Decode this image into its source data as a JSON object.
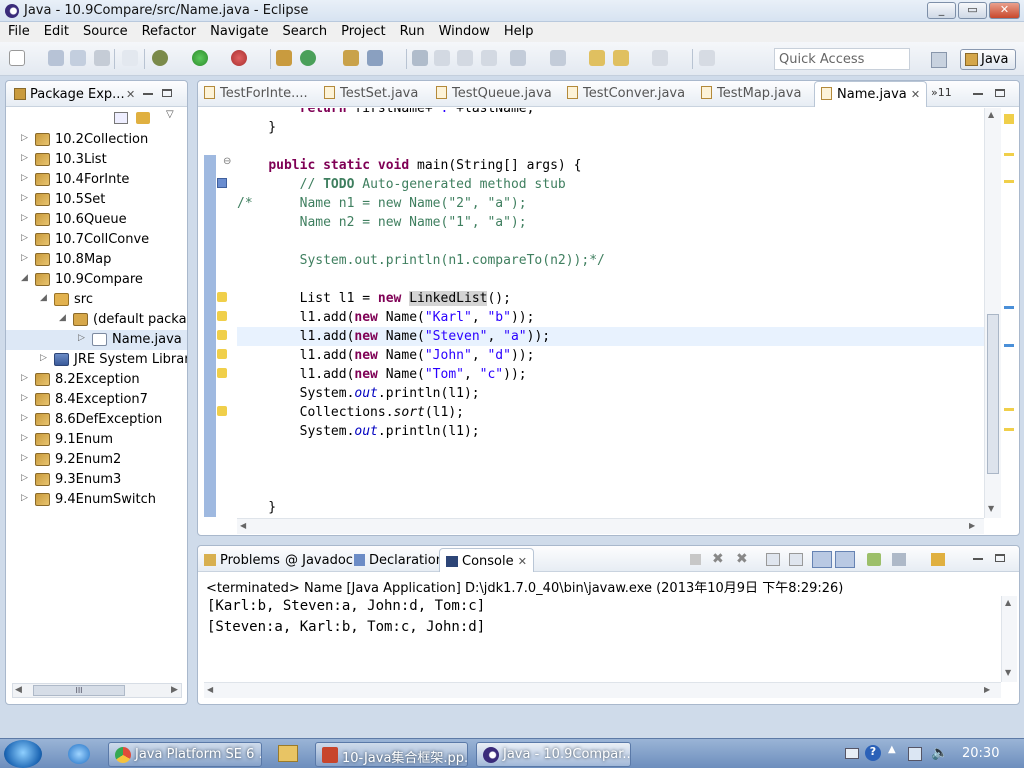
{
  "window": {
    "title": "Java - 10.9Compare/src/Name.java - Eclipse",
    "min": "_",
    "max": "▭",
    "close": "✕"
  },
  "menu": [
    "File",
    "Edit",
    "Source",
    "Refactor",
    "Navigate",
    "Search",
    "Project",
    "Run",
    "Window",
    "Help"
  ],
  "toolbar": {
    "quick_access": "Quick Access",
    "perspective": "Java"
  },
  "package_explorer": {
    "title": "Package Exp...",
    "items": [
      {
        "label": "10.2Collection"
      },
      {
        "label": "10.3List"
      },
      {
        "label": "10.4ForInte"
      },
      {
        "label": "10.5Set"
      },
      {
        "label": "10.6Queue"
      },
      {
        "label": "10.7CollConve"
      },
      {
        "label": "10.8Map"
      },
      {
        "label": "10.9Compare"
      },
      {
        "label": "src"
      },
      {
        "label": "(default packag"
      },
      {
        "label": "Name.java"
      },
      {
        "label": "JRE System Library"
      },
      {
        "label": "8.2Exception"
      },
      {
        "label": "8.4Exception7"
      },
      {
        "label": "8.6DefException"
      },
      {
        "label": "9.1Enum"
      },
      {
        "label": "9.2Enum2"
      },
      {
        "label": "9.3Enum3"
      },
      {
        "label": "9.4EnumSwitch"
      }
    ],
    "scroll_glyph": "III"
  },
  "editor": {
    "tabs": [
      "TestForInte....",
      "TestSet.java",
      "TestQueue.java",
      "TestConver.java",
      "TestMap.java",
      "Name.java"
    ],
    "overflow": "»11",
    "code": [
      "        return firstName+\":\"+lastName;",
      "    }",
      "",
      "    public static void main(String[] args) {",
      "        // TODO Auto-generated method stub",
      "/*      Name n1 = new Name(\"2\", \"a\");",
      "        Name n2 = new Name(\"1\", \"a\");",
      "",
      "        System.out.println(n1.compareTo(n2));*/",
      "",
      "        List l1 = new LinkedList();",
      "        l1.add(new Name(\"Karl\", \"b\"));",
      "        l1.add(new Name(\"Steven\", \"a\"));",
      "        l1.add(new Name(\"John\", \"d\"));",
      "        l1.add(new Name(\"Tom\", \"c\"));",
      "        System.out.println(l1);",
      "        Collections.sort(l1);",
      "        System.out.println(l1);",
      "",
      "",
      "",
      "    }"
    ]
  },
  "bottom": {
    "tabs": [
      "Problems",
      "@ Javadoc",
      "Declaration",
      "Console"
    ],
    "terminated": "<terminated> Name [Java Application] D:\\jdk1.7.0_40\\bin\\javaw.exe (2013年10月9日 下午8:29:26)",
    "output": [
      "[Karl:b, Steven:a, John:d, Tom:c]",
      "[Steven:a, Karl:b, Tom:c, John:d]"
    ]
  },
  "taskbar": {
    "tasks": [
      "Java Platform SE 6 ...",
      "10-Java集合框架.pp...",
      "Java - 10.9Compar..."
    ],
    "clock": "20:30"
  },
  "colors": {
    "keyword": "#7f0055",
    "comment": "#3f7f5f",
    "string": "#2a00ff",
    "accent": "#3d6fb5"
  }
}
